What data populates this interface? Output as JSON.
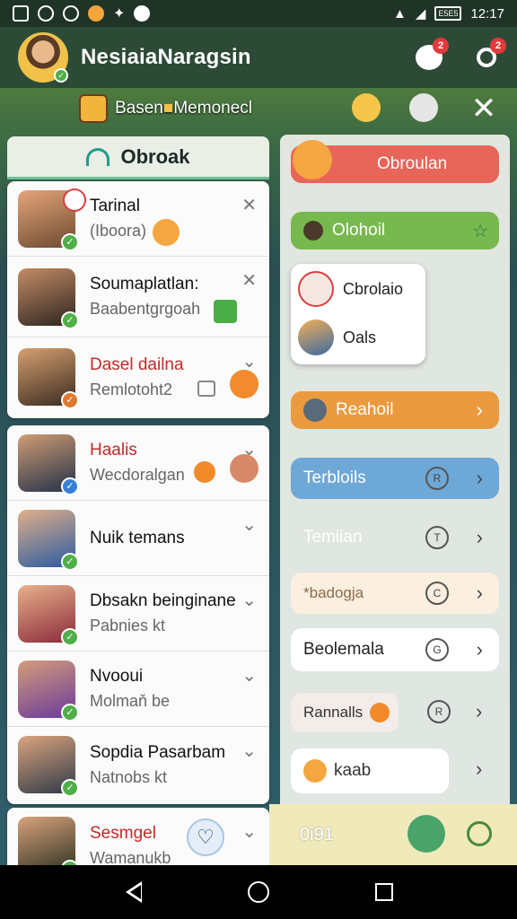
{
  "status_bar": {
    "time": "12:17",
    "battery": "E5E5"
  },
  "header": {
    "title": "NesiaiaNaragsin",
    "notif_badge_1": "2",
    "notif_badge_2": "2"
  },
  "promo": {
    "text": "Basen",
    "text2": "Memonecl"
  },
  "left_panel": {
    "title": "Obroak",
    "card1": [
      {
        "name": "Tarinal",
        "sub": "(Iboora)"
      },
      {
        "name": "Soumaplatlan:",
        "sub": "Baabentgrgoah"
      },
      {
        "name": "Dasel dailna",
        "sub": "Remlotoht2"
      }
    ],
    "card2": [
      {
        "name": "Haalis",
        "sub": "Wecdoralgan"
      },
      {
        "name": "Nuik temans",
        "sub": ""
      },
      {
        "name": "Dbsakn beinginane",
        "sub": "Pabnies kt"
      },
      {
        "name": "Nvooui",
        "sub": "Molmaň be"
      },
      {
        "name": "Sopdia Pasarbam",
        "sub": "Natnobs kt"
      }
    ],
    "card3": [
      {
        "name": "Sesmgel",
        "sub": "Wamanukb"
      }
    ]
  },
  "right_panel": {
    "top_pill": "Obroulan",
    "green_pill": "Olohoil",
    "popup": [
      "Cbrolaio",
      "Oals"
    ],
    "orange_pill": "Reahoil",
    "blue_pill": "Terbloils",
    "item1": "Temiian",
    "item2": "*badogja",
    "item3": "Beolemala",
    "item4": "Rannalls",
    "item5": "kaab",
    "bottom_text": "0i91"
  },
  "colors": {
    "accent_green": "#4fae48",
    "header": "#2d4a36",
    "red_pill": "#e8655a",
    "green_pill": "#78b94f",
    "orange_pill": "#ec9a3e",
    "blue_pill": "#6ea8d6"
  }
}
